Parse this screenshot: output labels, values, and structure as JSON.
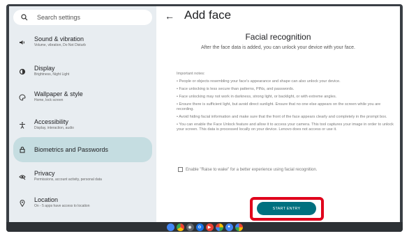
{
  "search": {
    "placeholder": "Search settings",
    "icon": "search-icon"
  },
  "sidebar": {
    "items": [
      {
        "title": "Sound & vibration",
        "sub": "Volume, vibration, Do Not Disturb",
        "icon": "speaker-icon"
      },
      {
        "title": "Display",
        "sub": "Brightness, Night Light",
        "icon": "display-icon"
      },
      {
        "title": "Wallpaper & style",
        "sub": "Home, lock screen",
        "icon": "palette-icon"
      },
      {
        "title": "Accessibility",
        "sub": "Display, interaction, audio",
        "icon": "accessibility-icon"
      },
      {
        "title": "Biometrics and Passwords",
        "sub": "",
        "icon": "lock-icon"
      },
      {
        "title": "Privacy",
        "sub": "Permissions, account activity, personal data",
        "icon": "privacy-icon"
      },
      {
        "title": "Location",
        "sub": "On - 5 apps have access to location",
        "icon": "location-icon"
      }
    ]
  },
  "header": {
    "back_icon": "back-arrow-icon",
    "title": "Add face"
  },
  "content": {
    "heading": "Facial recognition",
    "description": "After the face data is added, you can unlock your device with your face.",
    "notes_title": "Important notes:",
    "notes": [
      "• People or objects resembling your face's appearance and shape can also unlock your device.",
      "• Face unlocking is less secure than patterns, PINs, and passwords.",
      "• Face unlocking may not work in darkness, strong light, or backlight, or with extreme angles.",
      "• Ensure there is sufficient light, but avoid direct sunlight. Ensure that no one else appears on the screen while you are recording.",
      "• Avoid hiding facial information and make sure that the front of the face appears clearly and completely in the prompt box.",
      "• You can enable the Face Unlock feature and allow it to access your camera. This tool captures your image in order to unlock your screen. This data is processed locally on your device. Lenovo does not access or use it."
    ],
    "checkbox_label": "Enable \"Raise to wake\" for a better experience using facial recognition.",
    "start_button": "START ENTRY"
  },
  "colors": {
    "accent": "#00707f",
    "highlight": "#e0001b",
    "sidebar_bg": "#e8edf1",
    "selected_bg": "#c5dde1"
  },
  "dock": [
    "chrome-icon",
    "camera-icon",
    "settings-icon",
    "play-store-icon",
    "photos-icon",
    "assistant-icon",
    "apps-icon"
  ]
}
